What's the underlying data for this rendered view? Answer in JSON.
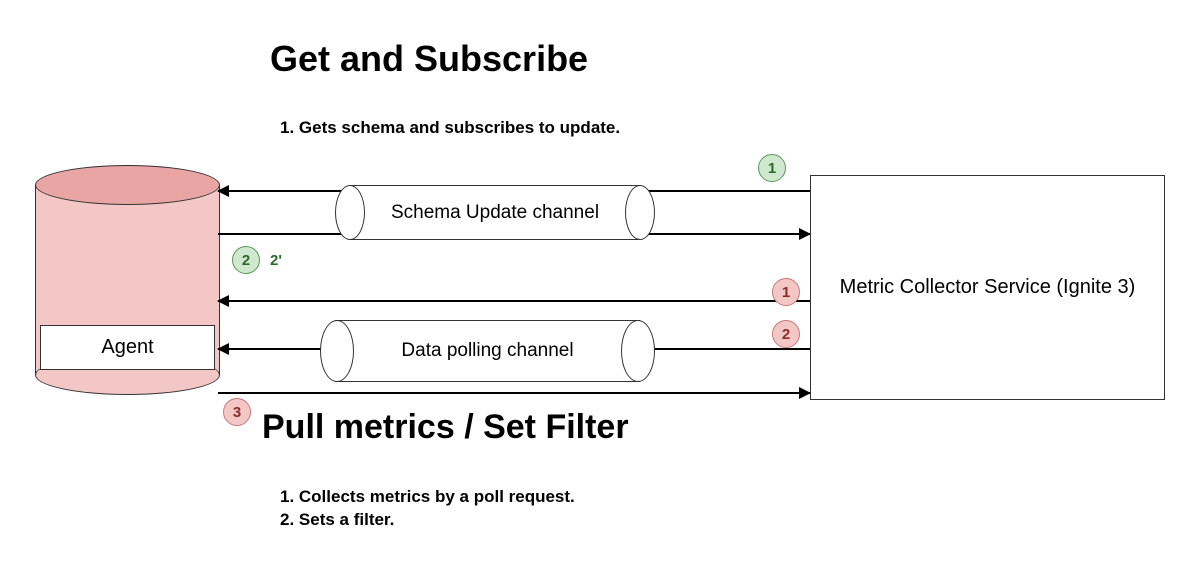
{
  "top": {
    "title": "Get and Subscribe",
    "subtitle": "1. Gets schema and subscribes to update."
  },
  "agent": {
    "label": "Agent"
  },
  "channels": {
    "schema": "Schema Update channel",
    "data": "Data polling channel"
  },
  "service": {
    "label": "Metric Collector Service (Ignite 3)"
  },
  "bottom": {
    "title": "Pull metrics / Set Filter",
    "item1": "1. Collects metrics by a poll request.",
    "item2": "2. Sets a filter."
  },
  "steps": {
    "g1": "1",
    "g2": "2",
    "g2p": "2'",
    "r1": "1",
    "r2": "2",
    "r3": "3"
  }
}
